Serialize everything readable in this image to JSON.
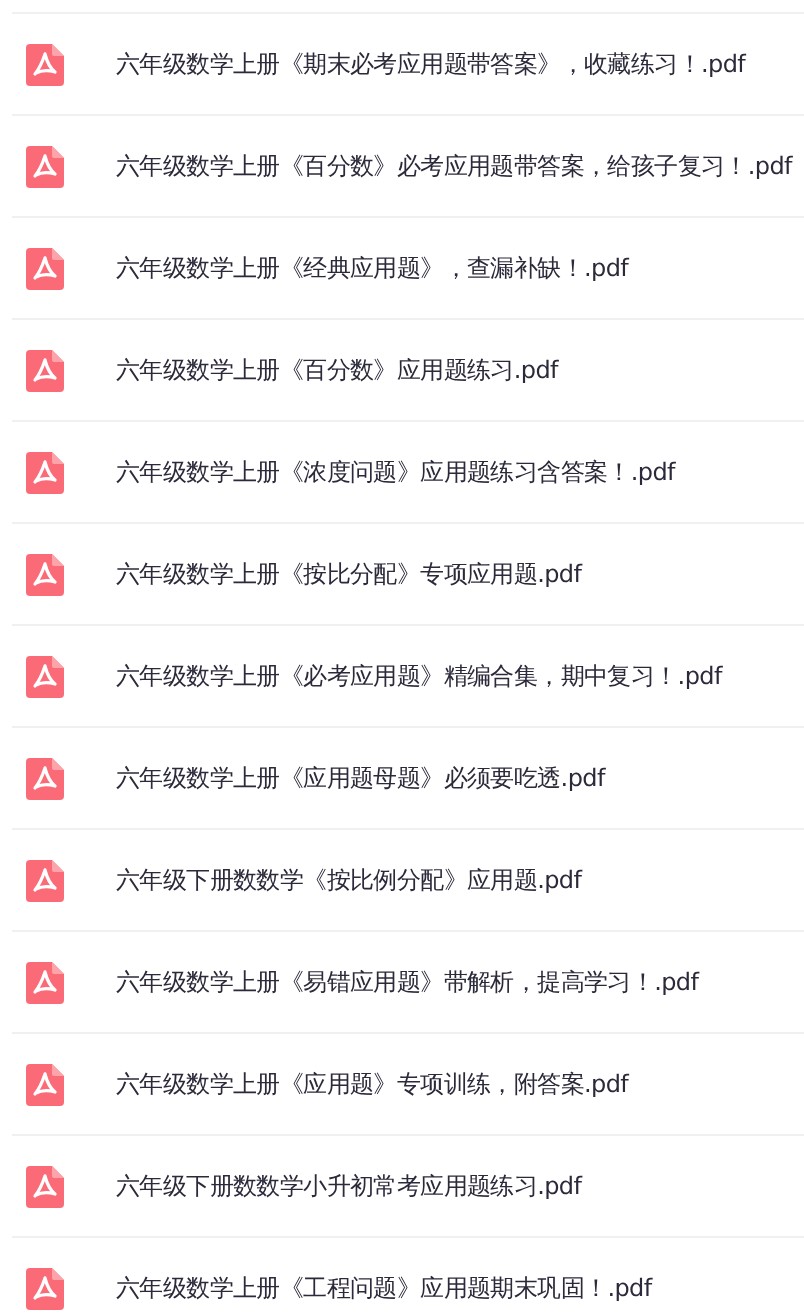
{
  "files": [
    {
      "name": "六年级数学上册《期末必考应用题带答案》，收藏练习！.pdf"
    },
    {
      "name": "六年级数学上册《百分数》必考应用题带答案，给孩子复习！.pdf"
    },
    {
      "name": "六年级数学上册《经典应用题》，查漏补缺！.pdf"
    },
    {
      "name": "六年级数学上册《百分数》应用题练习.pdf"
    },
    {
      "name": "六年级数学上册《浓度问题》应用题练习含答案！.pdf"
    },
    {
      "name": "六年级数学上册《按比分配》专项应用题.pdf"
    },
    {
      "name": "六年级数学上册《必考应用题》精编合集，期中复习！.pdf"
    },
    {
      "name": "六年级数学上册《应用题母题》必须要吃透.pdf"
    },
    {
      "name": "六年级下册数数学《按比例分配》应用题.pdf"
    },
    {
      "name": "六年级数学上册《易错应用题》带解析，提高学习！.pdf"
    },
    {
      "name": "六年级数学上册《应用题》专项训练，附答案.pdf"
    },
    {
      "name": "六年级下册数数学小升初常考应用题练习.pdf"
    },
    {
      "name": "六年级数学上册《工程问题》应用题期末巩固！.pdf"
    }
  ]
}
